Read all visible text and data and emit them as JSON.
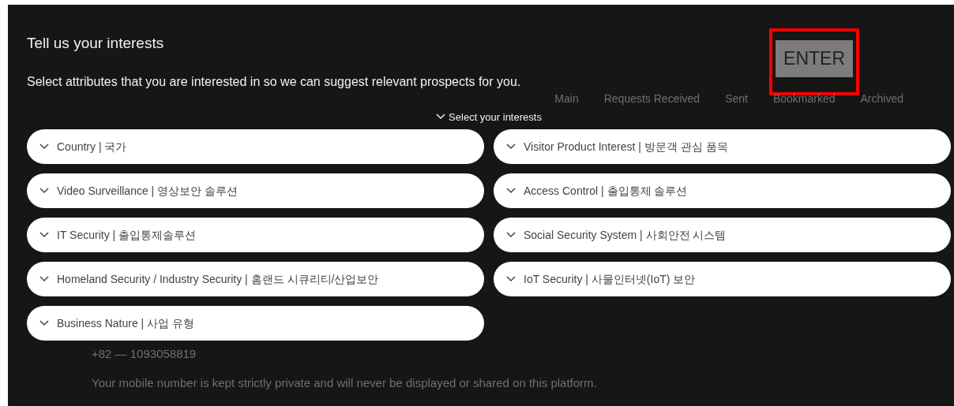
{
  "modal": {
    "title": "Tell us your interests",
    "subtitle": "Select attributes that you are interested in so we can suggest relevant prospects for you.",
    "enter_button": {
      "label": "ENTER",
      "highlighted": true
    },
    "section_toggle": {
      "label": "Select your interests",
      "expanded": true
    },
    "interests": [
      {
        "label": "Country | 국가",
        "expanded": false
      },
      {
        "label": "Visitor Product Interest | 방문객 관심 품목",
        "expanded": false
      },
      {
        "label": "Video Surveillance | 영상보안 솔루션",
        "expanded": false
      },
      {
        "label": "Access Control | 출입통제 솔루션",
        "expanded": false
      },
      {
        "label": "IT Security | 출입통제솔루션",
        "expanded": false
      },
      {
        "label": "Social Security System | 사회안전 시스템",
        "expanded": false
      },
      {
        "label": "Homeland Security / Industry Security | 홈랜드 시큐리티/산업보안",
        "expanded": false
      },
      {
        "label": "IoT Security | 사물인터넷(IoT) 보안",
        "expanded": false
      },
      {
        "label": "Business Nature | 사업 유형",
        "expanded": false
      }
    ]
  },
  "background": {
    "tabs": [
      "Main",
      "Requests Received",
      "Sent",
      "Bookmarked",
      "Archived"
    ],
    "phone": "+82 — 1093058819",
    "privacy_note": "Your mobile number is kept strictly private and will never be displayed or shared on this platform."
  }
}
